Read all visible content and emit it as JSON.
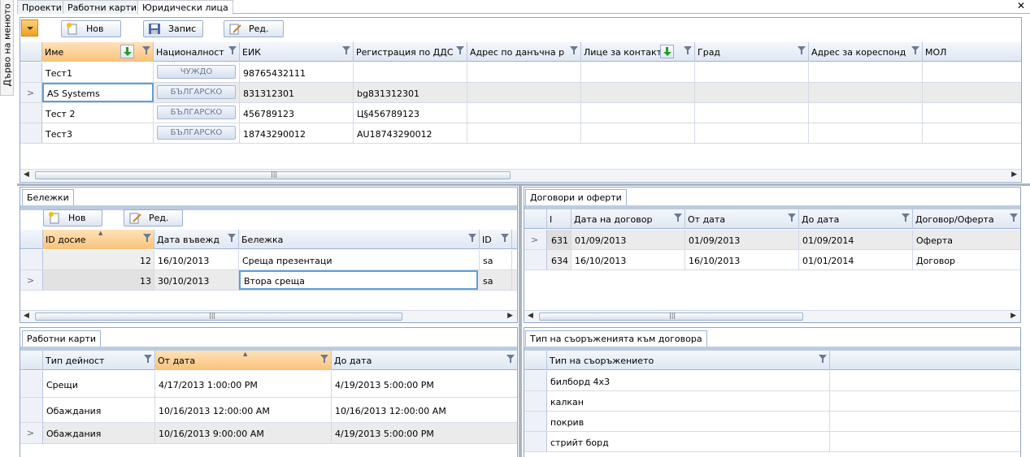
{
  "sidebar_tab": {
    "label": "Дърво на менюто"
  },
  "top_tabs": [
    {
      "label": "Проекти"
    },
    {
      "label": "Работни карти"
    },
    {
      "label": "Юридически лица"
    }
  ],
  "toolbar": {
    "new_label": "Нов",
    "save_label": "Запис",
    "edit_label": "Ред."
  },
  "legal_entities": {
    "columns": [
      "Име",
      "Националност",
      "ЕИК",
      "Регистрация по ДДС",
      "Адрес по данъчна р",
      "Лице за контакт",
      "Град",
      "Адрес за кореспонд",
      "МОЛ"
    ],
    "rows": [
      {
        "name": "Тест1",
        "nationality": "ЧУЖДО",
        "eik": "98765432111",
        "vat": ""
      },
      {
        "name": "AS Systems",
        "nationality": "БЪЛГАРСКО",
        "eik": "831312301",
        "vat": "bg831312301"
      },
      {
        "name": "Тест 2",
        "nationality": "БЪЛГАРСКО",
        "eik": "456789123",
        "vat": "Ц§456789123"
      },
      {
        "name": "Тест3",
        "nationality": "БЪЛГАРСКО",
        "eik": "18743290012",
        "vat": "AU18743290012"
      }
    ]
  },
  "notes": {
    "tab": "Бележки",
    "new_label": "Нов",
    "edit_label": "Ред.",
    "columns": [
      "ID досие",
      "Дата въвежд",
      "Бележка",
      "ID"
    ],
    "rows": [
      {
        "id": "12",
        "date": "16/10/2013",
        "note": "Среща презентаци",
        "user": "sa"
      },
      {
        "id": "13",
        "date": "30/10/2013",
        "note": "Втора среща",
        "user": "sa"
      }
    ]
  },
  "contracts": {
    "tab": "Договори и оферти",
    "columns": [
      "I",
      "Дата на договор",
      "От дата",
      "До дата",
      "Договор/Оферта"
    ],
    "rows": [
      {
        "id": "631",
        "contract_date": "01/09/2013",
        "from": "01/09/2013",
        "to": "01/09/2014",
        "kind": "Оферта"
      },
      {
        "id": "634",
        "contract_date": "16/10/2013",
        "from": "16/10/2013",
        "to": "01/01/2014",
        "kind": "Договор"
      }
    ]
  },
  "work_cards": {
    "tab": "Работни карти",
    "columns": [
      "Тип дейност",
      "От дата",
      "До дата"
    ],
    "rows": [
      {
        "type": "Срещи",
        "from": "4/17/2013 1:00:00 PM",
        "to": "4/19/2013 5:00:00 PM"
      },
      {
        "type": "Обаждания",
        "from": "10/16/2013 12:00:00 AM",
        "to": "10/16/2013 12:00:00 AM"
      },
      {
        "type": "Обаждания",
        "from": "10/16/2013 9:00:00 AM",
        "to": "4/19/2013 5:00:00 PM"
      }
    ]
  },
  "facility_types": {
    "tab": "Тип на съоръженията към договора",
    "columns": [
      "Тип на съоръжението"
    ],
    "rows": [
      {
        "type": "билборд 4х3"
      },
      {
        "type": "калкан"
      },
      {
        "type": "покрив"
      },
      {
        "type": "стрийт борд"
      }
    ]
  },
  "colors": {
    "accent": "#f8c27a",
    "border": "#8fa6c8",
    "focus": "#5f9fd6"
  }
}
